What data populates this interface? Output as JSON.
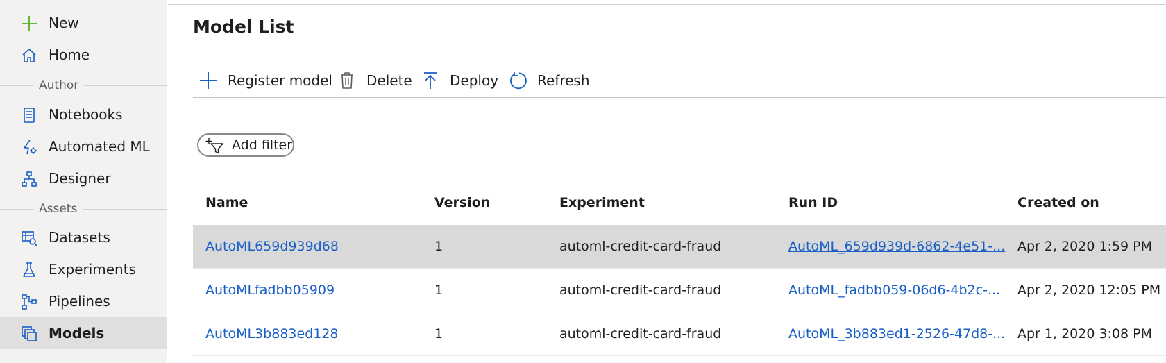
{
  "sidebar": {
    "items": [
      {
        "label": "New",
        "icon": "plus-icon"
      },
      {
        "label": "Home",
        "icon": "home-icon"
      },
      {
        "label": "Notebooks",
        "icon": "notebook-icon"
      },
      {
        "label": "Automated ML",
        "icon": "automated-ml-icon"
      },
      {
        "label": "Designer",
        "icon": "designer-icon"
      },
      {
        "label": "Datasets",
        "icon": "dataset-icon"
      },
      {
        "label": "Experiments",
        "icon": "flask-icon"
      },
      {
        "label": "Pipelines",
        "icon": "pipeline-icon"
      },
      {
        "label": "Models",
        "icon": "models-icon"
      }
    ],
    "sections": [
      "Author",
      "Assets"
    ],
    "active": "Models"
  },
  "main": {
    "title": "Model List",
    "toolbar": {
      "register_label": "Register model",
      "delete_label": "Delete",
      "deploy_label": "Deploy",
      "refresh_label": "Refresh"
    },
    "filter_label": "Add filter",
    "table": {
      "columns": [
        "Name",
        "Version",
        "Experiment",
        "Run ID",
        "Created on"
      ],
      "rows": [
        {
          "name": "AutoML659d939d68",
          "version": "1",
          "experiment": "automl-credit-card-fraud",
          "run_id": "AutoML_659d939d-6862-4e51-...",
          "created": "Apr 2, 2020 1:59 PM"
        },
        {
          "name": "AutoMLfadbb05909",
          "version": "1",
          "experiment": "automl-credit-card-fraud",
          "run_id": "AutoML_fadbb059-06d6-4b2c-...",
          "created": "Apr 2, 2020 12:05 PM"
        },
        {
          "name": "AutoML3b883ed128",
          "version": "1",
          "experiment": "automl-credit-card-fraud",
          "run_id": "AutoML_3b883ed1-2526-47d8-...",
          "created": "Apr 1, 2020 3:08 PM"
        }
      ]
    }
  },
  "colors": {
    "accent": "#1a5fc6",
    "plus_green": "#5fb832",
    "sidebar_bg": "#f3f2f1",
    "selected_row": "#d9d9d9"
  }
}
